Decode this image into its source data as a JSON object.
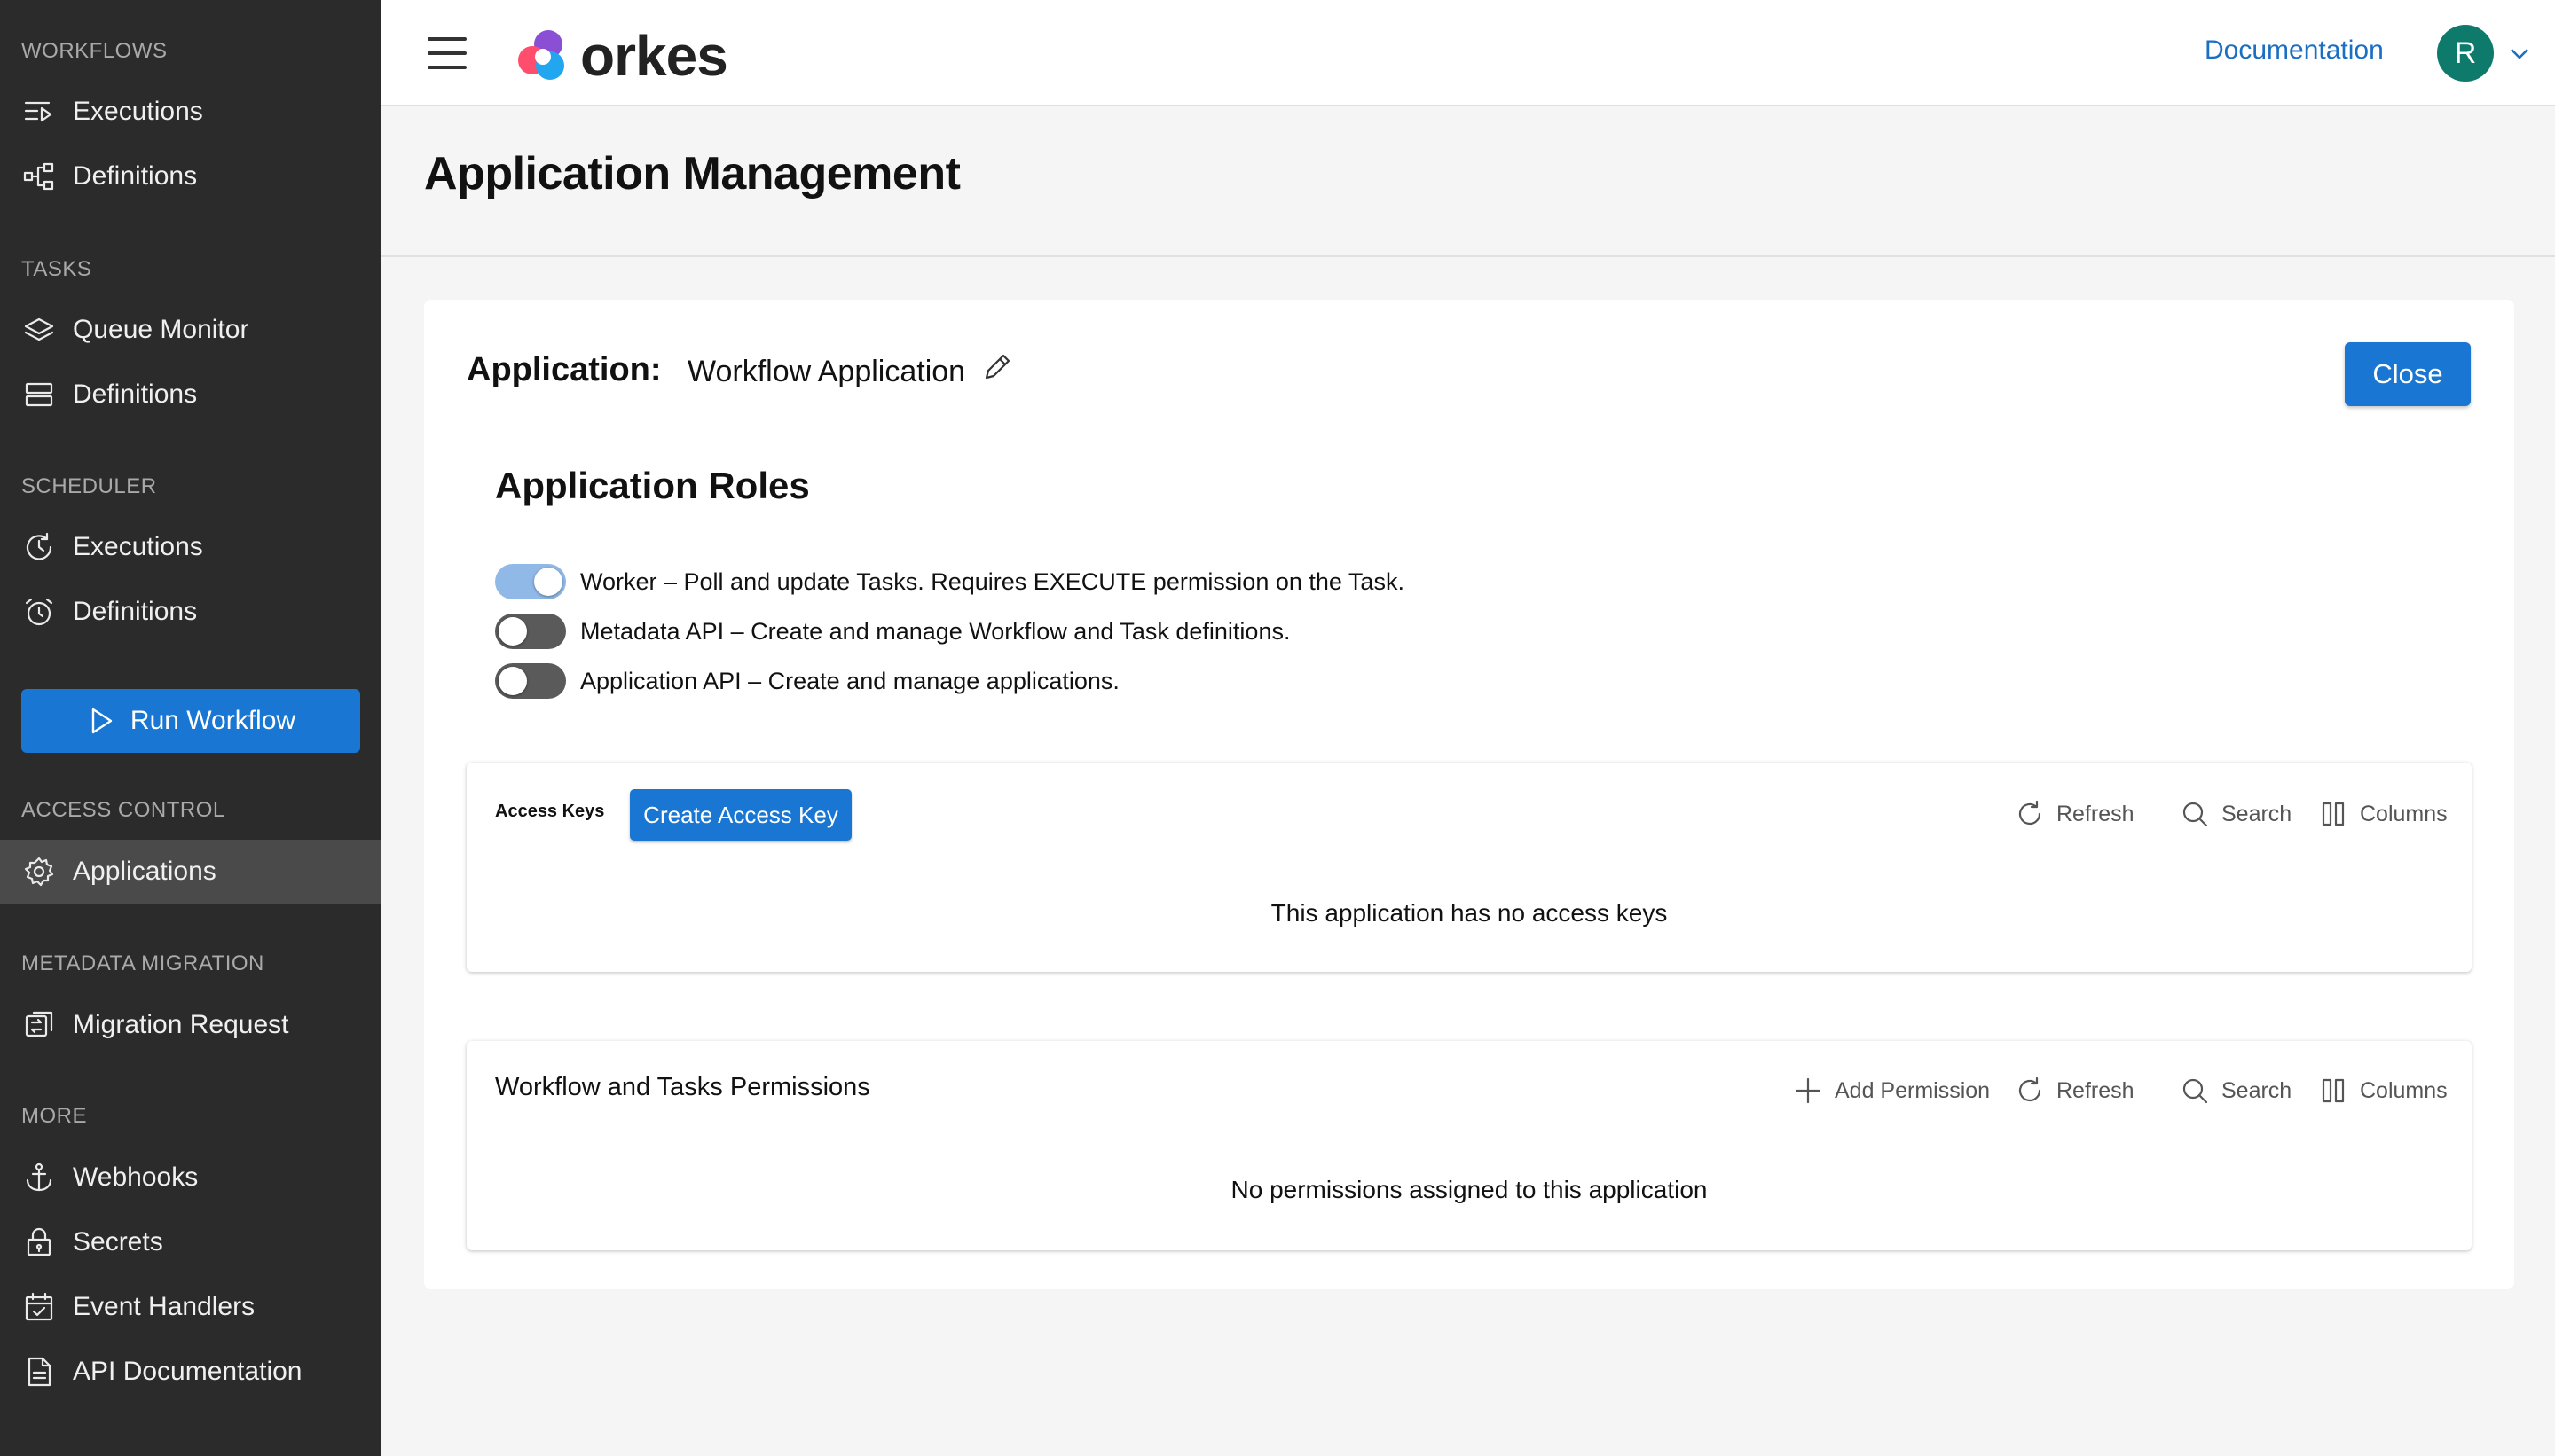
{
  "sidebar": {
    "sections": {
      "workflows": "WORKFLOWS",
      "tasks": "TASKS",
      "scheduler": "SCHEDULER",
      "access_control": "ACCESS CONTROL",
      "metadata_migration": "METADATA MIGRATION",
      "more": "MORE"
    },
    "items": {
      "wf_executions": "Executions",
      "wf_definitions": "Definitions",
      "queue_monitor": "Queue Monitor",
      "task_definitions": "Definitions",
      "sched_executions": "Executions",
      "sched_definitions": "Definitions",
      "applications": "Applications",
      "migration_request": "Migration Request",
      "webhooks": "Webhooks",
      "secrets": "Secrets",
      "event_handlers": "Event Handlers",
      "api_documentation": "API Documentation"
    },
    "run_workflow": "Run Workflow"
  },
  "topbar": {
    "logo_text": "orkes",
    "documentation": "Documentation",
    "avatar_initial": "R"
  },
  "page": {
    "title": "Application Management"
  },
  "application": {
    "label": "Application:",
    "name": "Workflow Application",
    "close_label": "Close",
    "roles_title": "Application Roles",
    "roles": [
      {
        "text": "Worker – Poll and update Tasks. Requires EXECUTE permission on the Task.",
        "enabled": true
      },
      {
        "text": "Metadata API – Create and manage Workflow and Task definitions.",
        "enabled": false
      },
      {
        "text": "Application API – Create and manage applications.",
        "enabled": false
      }
    ]
  },
  "access_keys": {
    "title": "Access Keys",
    "create_label": "Create Access Key",
    "refresh": "Refresh",
    "search": "Search",
    "columns": "Columns",
    "empty": "This application has no access keys"
  },
  "permissions": {
    "title": "Workflow and Tasks Permissions",
    "add_label": "Add Permission",
    "refresh": "Refresh",
    "search": "Search",
    "columns": "Columns",
    "empty": "No permissions assigned to this application"
  },
  "colors": {
    "sidebar_bg": "#2b2b2b",
    "sidebar_active": "#4a4a4a",
    "primary": "#1976d2",
    "link": "#1a6fc2",
    "avatar": "#0d7a6b",
    "toggle_on": "#90b9e8"
  }
}
